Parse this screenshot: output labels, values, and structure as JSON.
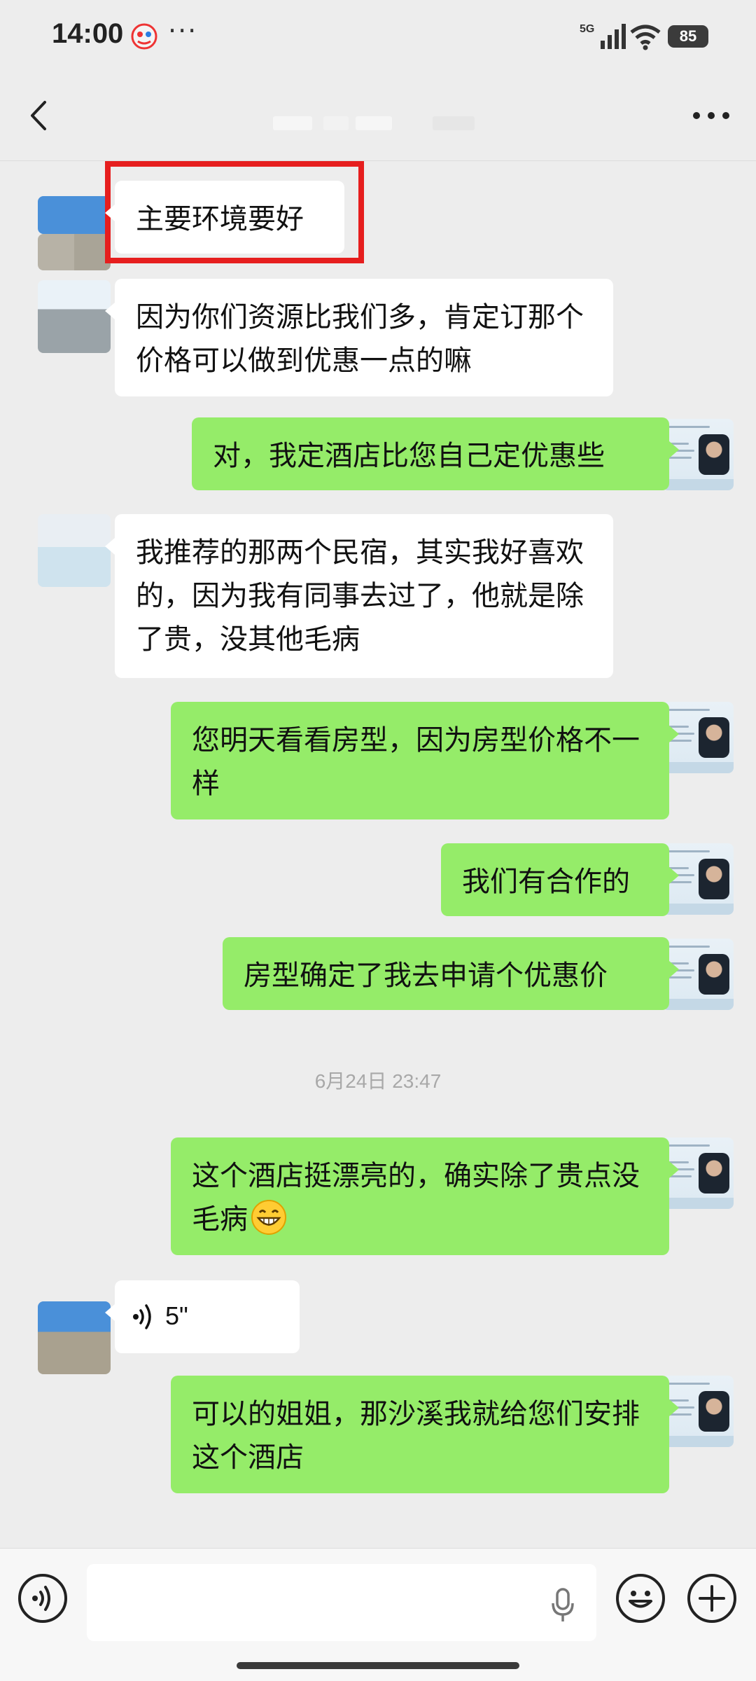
{
  "status_bar": {
    "time": "14:00",
    "dots": "···",
    "network": "5G",
    "battery": "85",
    "icons": [
      "app-notification-icon",
      "signal-icon",
      "wifi-icon",
      "battery-icon"
    ]
  },
  "nav": {
    "back_icon": "chevron-left-icon",
    "more_icon": "more-dots-icon"
  },
  "messages": [
    {
      "side": "left",
      "text": "主要环境要好",
      "highlighted": true
    },
    {
      "side": "left",
      "text": "因为你们资源比我们多，肯定订那个价格可以做到优惠一点的嘛"
    },
    {
      "side": "right",
      "text": "对，我定酒店比您自己定优惠些"
    },
    {
      "side": "left",
      "text": "我推荐的那两个民宿，其实我好喜欢的，因为我有同事去过了，他就是除了贵，没其他毛病"
    },
    {
      "side": "right",
      "text": "您明天看看房型，因为房型价格不一样"
    },
    {
      "side": "right",
      "text": "我们有合作的"
    },
    {
      "side": "right",
      "text": "房型确定了我去申请个优惠价"
    },
    {
      "type": "timestamp",
      "text": "6月24日 23:47"
    },
    {
      "side": "right",
      "text": "这个酒店挺漂亮的，确实除了贵点没毛病",
      "emoji": "grinning-face-icon"
    },
    {
      "side": "left",
      "type": "voice",
      "duration": "5\""
    },
    {
      "side": "right",
      "text": "可以的姐姐，那沙溪我就给您们安排这个酒店"
    }
  ],
  "input_bar": {
    "voice_toggle_icon": "voice-toggle-icon",
    "text_value": "",
    "mic_icon": "microphone-icon",
    "emoji_icon": "smiley-icon",
    "plus_icon": "plus-icon"
  },
  "colors": {
    "background": "#ededed",
    "sent_bubble": "#95ec69",
    "received_bubble": "#ffffff",
    "highlight": "#e61e1e"
  }
}
